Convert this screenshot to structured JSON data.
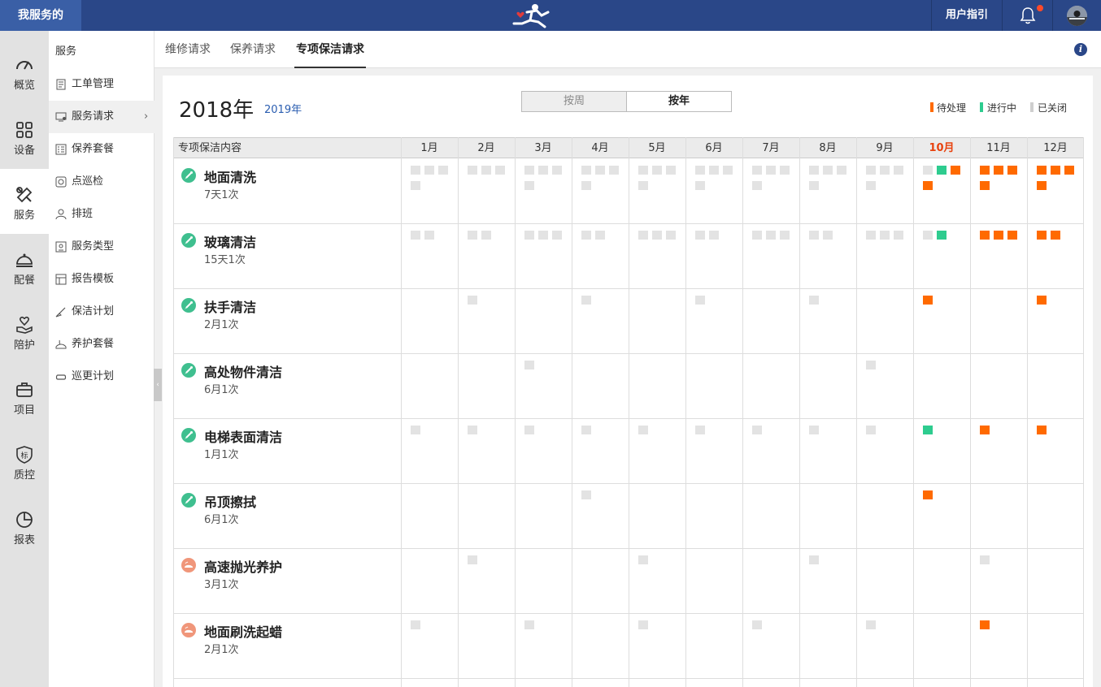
{
  "app": {
    "title": "我服务的",
    "guide": "用户指引"
  },
  "iconbar": [
    {
      "label": "概览",
      "icon": "gauge-icon"
    },
    {
      "label": "设备",
      "icon": "grid-icon"
    },
    {
      "label": "服务",
      "icon": "wrench-icon"
    },
    {
      "label": "配餐",
      "icon": "cloche-icon"
    },
    {
      "label": "陪护",
      "icon": "hand-heart-icon"
    },
    {
      "label": "项目",
      "icon": "briefcase-icon"
    },
    {
      "label": "质控",
      "icon": "shield-icon"
    },
    {
      "label": "报表",
      "icon": "pie-icon"
    }
  ],
  "submenu": {
    "heading": "服务",
    "items": [
      {
        "label": "工单管理",
        "icon": "document-icon"
      },
      {
        "label": "服务请求",
        "icon": "monitor-user-icon"
      },
      {
        "label": "保养套餐",
        "icon": "checklist-icon"
      },
      {
        "label": "点巡检",
        "icon": "inspect-icon"
      },
      {
        "label": "排班",
        "icon": "person-icon"
      },
      {
        "label": "服务类型",
        "icon": "id-card-icon"
      },
      {
        "label": "报告模板",
        "icon": "template-icon"
      },
      {
        "label": "保洁计划",
        "icon": "cleaning-icon"
      },
      {
        "label": "养护套餐",
        "icon": "care-icon"
      },
      {
        "label": "巡更计划",
        "icon": "loop-icon"
      }
    ]
  },
  "tabs": [
    "维修请求",
    "保养请求",
    "专项保洁请求"
  ],
  "header": {
    "year": "2018年",
    "next_year": "2019年",
    "toggle": {
      "week": "按周",
      "year": "按年"
    }
  },
  "legend": [
    {
      "label": "待处理",
      "color": "#ff6a00"
    },
    {
      "label": "进行中",
      "color": "#2ecc8f"
    },
    {
      "label": "已关闭",
      "color": "#cfcfcf"
    }
  ],
  "table": {
    "first_col": "专项保洁内容",
    "months": [
      "1月",
      "2月",
      "3月",
      "4月",
      "5月",
      "6月",
      "7月",
      "8月",
      "9月",
      "10月",
      "11月",
      "12月"
    ],
    "current_month_index": 9,
    "rows": [
      {
        "name": "地面清洗",
        "freq": "7天1次",
        "kind": "cleaning",
        "cells": [
          [
            "g",
            "g",
            "g",
            "g"
          ],
          [
            "g",
            "g",
            "g"
          ],
          [
            "g",
            "g",
            "g",
            "g"
          ],
          [
            "g",
            "g",
            "g",
            "g"
          ],
          [
            "g",
            "g",
            "g",
            "g"
          ],
          [
            "g",
            "g",
            "g",
            "g"
          ],
          [
            "g",
            "g",
            "g",
            "g"
          ],
          [
            "g",
            "g",
            "g",
            "g"
          ],
          [
            "g",
            "g",
            "g",
            "g"
          ],
          [
            "g",
            "t",
            "o",
            "o"
          ],
          [
            "o",
            "o",
            "o",
            "o"
          ],
          [
            "o",
            "o",
            "o",
            "o"
          ]
        ]
      },
      {
        "name": "玻璃清洁",
        "freq": "15天1次",
        "kind": "cleaning",
        "cells": [
          [
            "g",
            "g"
          ],
          [
            "g",
            "g"
          ],
          [
            "g",
            "g",
            "g"
          ],
          [
            "g",
            "g"
          ],
          [
            "g",
            "g",
            "g"
          ],
          [
            "g",
            "g"
          ],
          [
            "g",
            "g",
            "g"
          ],
          [
            "g",
            "g"
          ],
          [
            "g",
            "g",
            "g"
          ],
          [
            "g",
            "t"
          ],
          [
            "o",
            "o",
            "o"
          ],
          [
            "o",
            "o"
          ]
        ]
      },
      {
        "name": "扶手清洁",
        "freq": "2月1次",
        "kind": "cleaning",
        "cells": [
          [],
          [
            "g"
          ],
          [],
          [
            "g"
          ],
          [],
          [
            "g"
          ],
          [],
          [
            "g"
          ],
          [],
          [
            "o"
          ],
          [],
          [
            "o"
          ]
        ]
      },
      {
        "name": "高处物件清洁",
        "freq": "6月1次",
        "kind": "cleaning",
        "cells": [
          [],
          [],
          [
            "g"
          ],
          [],
          [],
          [],
          [],
          [],
          [
            "g"
          ],
          [],
          [],
          []
        ]
      },
      {
        "name": "电梯表面清洁",
        "freq": "1月1次",
        "kind": "cleaning",
        "cells": [
          [
            "g"
          ],
          [
            "g"
          ],
          [
            "g"
          ],
          [
            "g"
          ],
          [
            "g"
          ],
          [
            "g"
          ],
          [
            "g"
          ],
          [
            "g"
          ],
          [
            "g"
          ],
          [
            "t"
          ],
          [
            "o"
          ],
          [
            "o"
          ]
        ]
      },
      {
        "name": "吊顶擦拭",
        "freq": "6月1次",
        "kind": "cleaning",
        "cells": [
          [],
          [],
          [],
          [
            "g"
          ],
          [],
          [],
          [],
          [],
          [],
          [
            "o"
          ],
          [],
          []
        ]
      },
      {
        "name": "高速抛光养护",
        "freq": "3月1次",
        "kind": "care",
        "cells": [
          [],
          [
            "g"
          ],
          [],
          [],
          [
            "g"
          ],
          [],
          [],
          [
            "g"
          ],
          [],
          [],
          [
            "g"
          ],
          []
        ]
      },
      {
        "name": "地面刷洗起蜡",
        "freq": "2月1次",
        "kind": "care",
        "cells": [
          [
            "g"
          ],
          [],
          [
            "g"
          ],
          [],
          [
            "g"
          ],
          [],
          [
            "g"
          ],
          [],
          [
            "g"
          ],
          [],
          [
            "o"
          ],
          []
        ]
      }
    ]
  }
}
